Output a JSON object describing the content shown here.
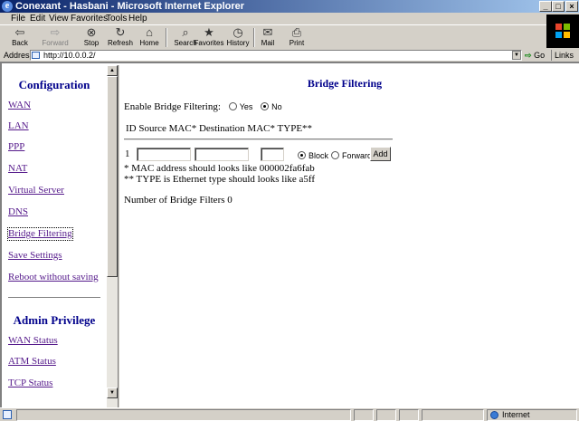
{
  "window": {
    "title": "Conexant - Hasbani - Microsoft Internet Explorer",
    "controls": [
      "_",
      "□",
      "×"
    ]
  },
  "menubar": {
    "items": [
      "File",
      "Edit",
      "View",
      "Favorites",
      "Tools",
      "Help"
    ]
  },
  "toolbar": {
    "buttons": [
      {
        "label": "Back",
        "icon": "back-arrow-icon",
        "enabled": true
      },
      {
        "label": "Forward",
        "icon": "forward-arrow-icon",
        "enabled": false
      },
      {
        "label": "Stop",
        "icon": "stop-icon",
        "enabled": true
      },
      {
        "label": "Refresh",
        "icon": "refresh-icon",
        "enabled": true
      },
      {
        "label": "Home",
        "icon": "home-icon",
        "enabled": true
      },
      {
        "label": "Search",
        "icon": "search-icon",
        "enabled": true
      },
      {
        "label": "Favorites",
        "icon": "favorites-icon",
        "enabled": true
      },
      {
        "label": "History",
        "icon": "history-icon",
        "enabled": true
      },
      {
        "label": "Mail",
        "icon": "mail-icon",
        "enabled": true
      },
      {
        "label": "Print",
        "icon": "print-icon",
        "enabled": true
      }
    ]
  },
  "addressbar": {
    "label": "Address",
    "url": "http://10.0.0.2/",
    "go_label": "Go",
    "links_label": "Links »"
  },
  "sidebar": {
    "heading": "Configuration",
    "links": [
      {
        "label": "WAN"
      },
      {
        "label": "LAN"
      },
      {
        "label": "PPP"
      },
      {
        "label": "NAT"
      },
      {
        "label": "Virtual Server"
      },
      {
        "label": "DNS"
      },
      {
        "label": "Bridge Filtering",
        "active": true
      },
      {
        "label": "Save Settings"
      },
      {
        "label": "Reboot without saving"
      }
    ],
    "admin_heading": "Admin Privilege",
    "admin_links": [
      {
        "label": "WAN Status"
      },
      {
        "label": "ATM Status"
      },
      {
        "label": "TCP Status"
      }
    ]
  },
  "main": {
    "title": "Bridge Filtering",
    "enable_label": "Enable Bridge Filtering:",
    "enable_options": [
      {
        "label": "Yes",
        "checked": false
      },
      {
        "label": "No",
        "checked": true
      }
    ],
    "column_headers": "ID Source MAC*  Destination MAC* TYPE**",
    "entry": {
      "id": "1",
      "source_mac": "",
      "destination_mac": "",
      "type": "",
      "actions": [
        {
          "label": "Block",
          "checked": true
        },
        {
          "label": "Forward",
          "checked": false
        }
      ],
      "add_label": "Add"
    },
    "note_mac": "* MAC address should looks like 000002fa6fab",
    "note_type": "** TYPE is Ethernet type should looks like a5ff",
    "filter_count_label": "Number of Bridge Filters 0"
  },
  "statusbar": {
    "status_text": "",
    "zone": "Internet"
  },
  "colors": {
    "title_bar": "#0a246a",
    "heading_text": "#00008b",
    "link_visited": "#551a8b",
    "chrome": "#d4d0c8"
  }
}
